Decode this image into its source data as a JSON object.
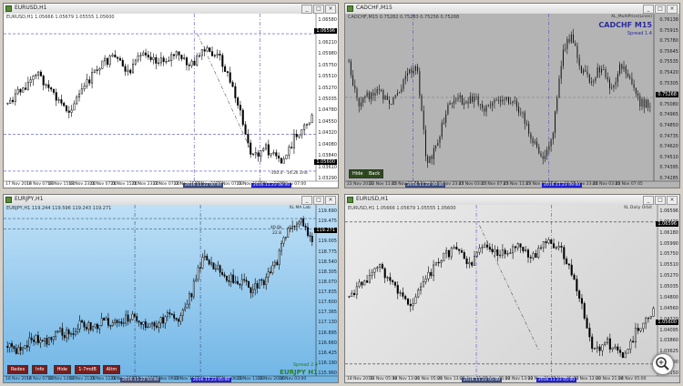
{
  "windows": {
    "w1": {
      "title": "EURUSD,H1",
      "info": "EURUSD,H1  1.05666 1.05679 1.05555 1.05600",
      "prices": [
        "1.06580",
        "1.06340",
        "1.06210",
        "1.05980",
        "1.05750",
        "1.05510",
        "1.05270",
        "1.05035",
        "1.04780",
        "1.04550",
        "1.04320",
        "1.04080",
        "1.03840",
        "1.03610",
        "1.03290"
      ],
      "price_tag": "1.05600",
      "price_tag_top": "1.06596",
      "times": [
        "17 Nov 2016",
        "18 Nov 07:00",
        "18 Nov 15:00",
        "18 Nov 23:00",
        "21 Nov 07:00",
        "21 Nov 15:00",
        "21 Nov 23:00",
        "22 Nov 07:00",
        "22 Nov 15:00",
        "22 Nov 23:00",
        "23 Nov 07:00",
        "23 Nov 15:00",
        "23 Nov 23:00",
        "24 Nov 07:00"
      ],
      "highlight1": "2016.11.22 00:00",
      "highlight2": "2016.11.23 08:00",
      "fib_label": "-100.0 - 16.2k 2nd"
    },
    "w2": {
      "title": "CADCHF,M15",
      "info": "CADCHF,M15  0.75282 0.75283 0.75256 0.75268",
      "symbol": "CADCHF M15",
      "spread": "Spread 1.4",
      "indicator": "XL_MultiPrice(Lines)",
      "prices": [
        "0.76138",
        "0.75915",
        "0.75780",
        "0.75645",
        "0.75535",
        "0.75420",
        "0.75305",
        "0.75190",
        "0.75080",
        "0.74965",
        "0.74850",
        "0.74735",
        "0.74620",
        "0.74510",
        "0.74395",
        "0.74285"
      ],
      "price_tag": "0.75268",
      "times": [
        "22 Nov 2016",
        "22 Nov 11:45",
        "22 Nov 15:45",
        "22 Nov 19:45",
        "22 Nov 23:45",
        "23 Nov 03:45",
        "23 Nov 07:45",
        "23 Nov 11:45",
        "23 Nov 15:45",
        "23 Nov 19:45",
        "23 Nov 23:45",
        "24 Nov 03:45",
        "24 Nov 07:45"
      ],
      "highlight1": "2016.11.22 09:00",
      "highlight2": "2016.11.23 09:00",
      "btn1": "Hide",
      "btn2": "Back"
    },
    "w3": {
      "title": "EURJPY,H1",
      "info": "EURJPY,H1  119.244 119.596 119.243 119.271",
      "indicator": "XL MA Lab",
      "symbol": "EURJPY H1",
      "spread": "Spread 2.4",
      "ann1": "40.6k",
      "ann2": "22.8",
      "prices": [
        "119.690",
        "119.475",
        "119.240",
        "119.005",
        "118.775",
        "118.540",
        "118.305",
        "118.070",
        "117.835",
        "117.600",
        "117.365",
        "117.130",
        "116.895",
        "116.660",
        "116.425",
        "116.190",
        "115.960"
      ],
      "price_tag": "119.271",
      "times": [
        "18 Nov 2016",
        "18 Nov 07:00",
        "18 Nov 14:00",
        "18 Nov 21:00",
        "21 Nov 12:00",
        "21 Nov 19:00",
        "22 Nov 02:00",
        "22 Nov 09:00",
        "22 Nov 16:00",
        "22 Nov 23:00",
        "23 Nov 06:00",
        "23 Nov 13:00",
        "23 Nov 20:00",
        "24 Nov 03:00"
      ],
      "highlight1": "2016.11.22 03:00",
      "highlight2": "2016.11.23 05:00",
      "buttons": [
        "Redes",
        "Info",
        "Hide",
        "1-7mdB",
        "Altm"
      ]
    },
    "w4": {
      "title": "EURUSD,H1",
      "info": "EURUSD,H1  1.05666 1.05679 1.05555 1.05600",
      "indicator": "XL Daily Orbit",
      "prices": [
        "1.06596",
        "1.06420",
        "1.06180",
        "1.05990",
        "1.05750",
        "1.05510",
        "1.05270",
        "1.05035",
        "1.04800",
        "1.04560",
        "1.04320",
        "1.04095",
        "1.03860",
        "1.03625",
        "1.03390",
        "1.03150"
      ],
      "price_tag": "1.05600",
      "price_tag_top": "1.06596",
      "times": [
        "18 Nov 2016",
        "18 Nov 05:00",
        "18 Nov 13:00",
        "21 Nov 05:00",
        "21 Nov 13:00",
        "21 Nov 21:00",
        "22 Nov 05:00",
        "22 Nov 13:00",
        "22 Nov 21:00",
        "23 Nov 05:00",
        "23 Nov 13:00",
        "23 Nov 21:00",
        "24 Nov 05:00"
      ],
      "highlight1": "2016.11.22 05:00",
      "highlight2": "2016.11.23 05:00"
    }
  },
  "colors": {
    "bull": "#ffffff",
    "bear": "#000000",
    "vline": "#6060d0",
    "hl_dark": "#3a4a7a",
    "hl_blue": "#2020c8"
  },
  "icons": {
    "zoom": "magnifier-icon"
  }
}
